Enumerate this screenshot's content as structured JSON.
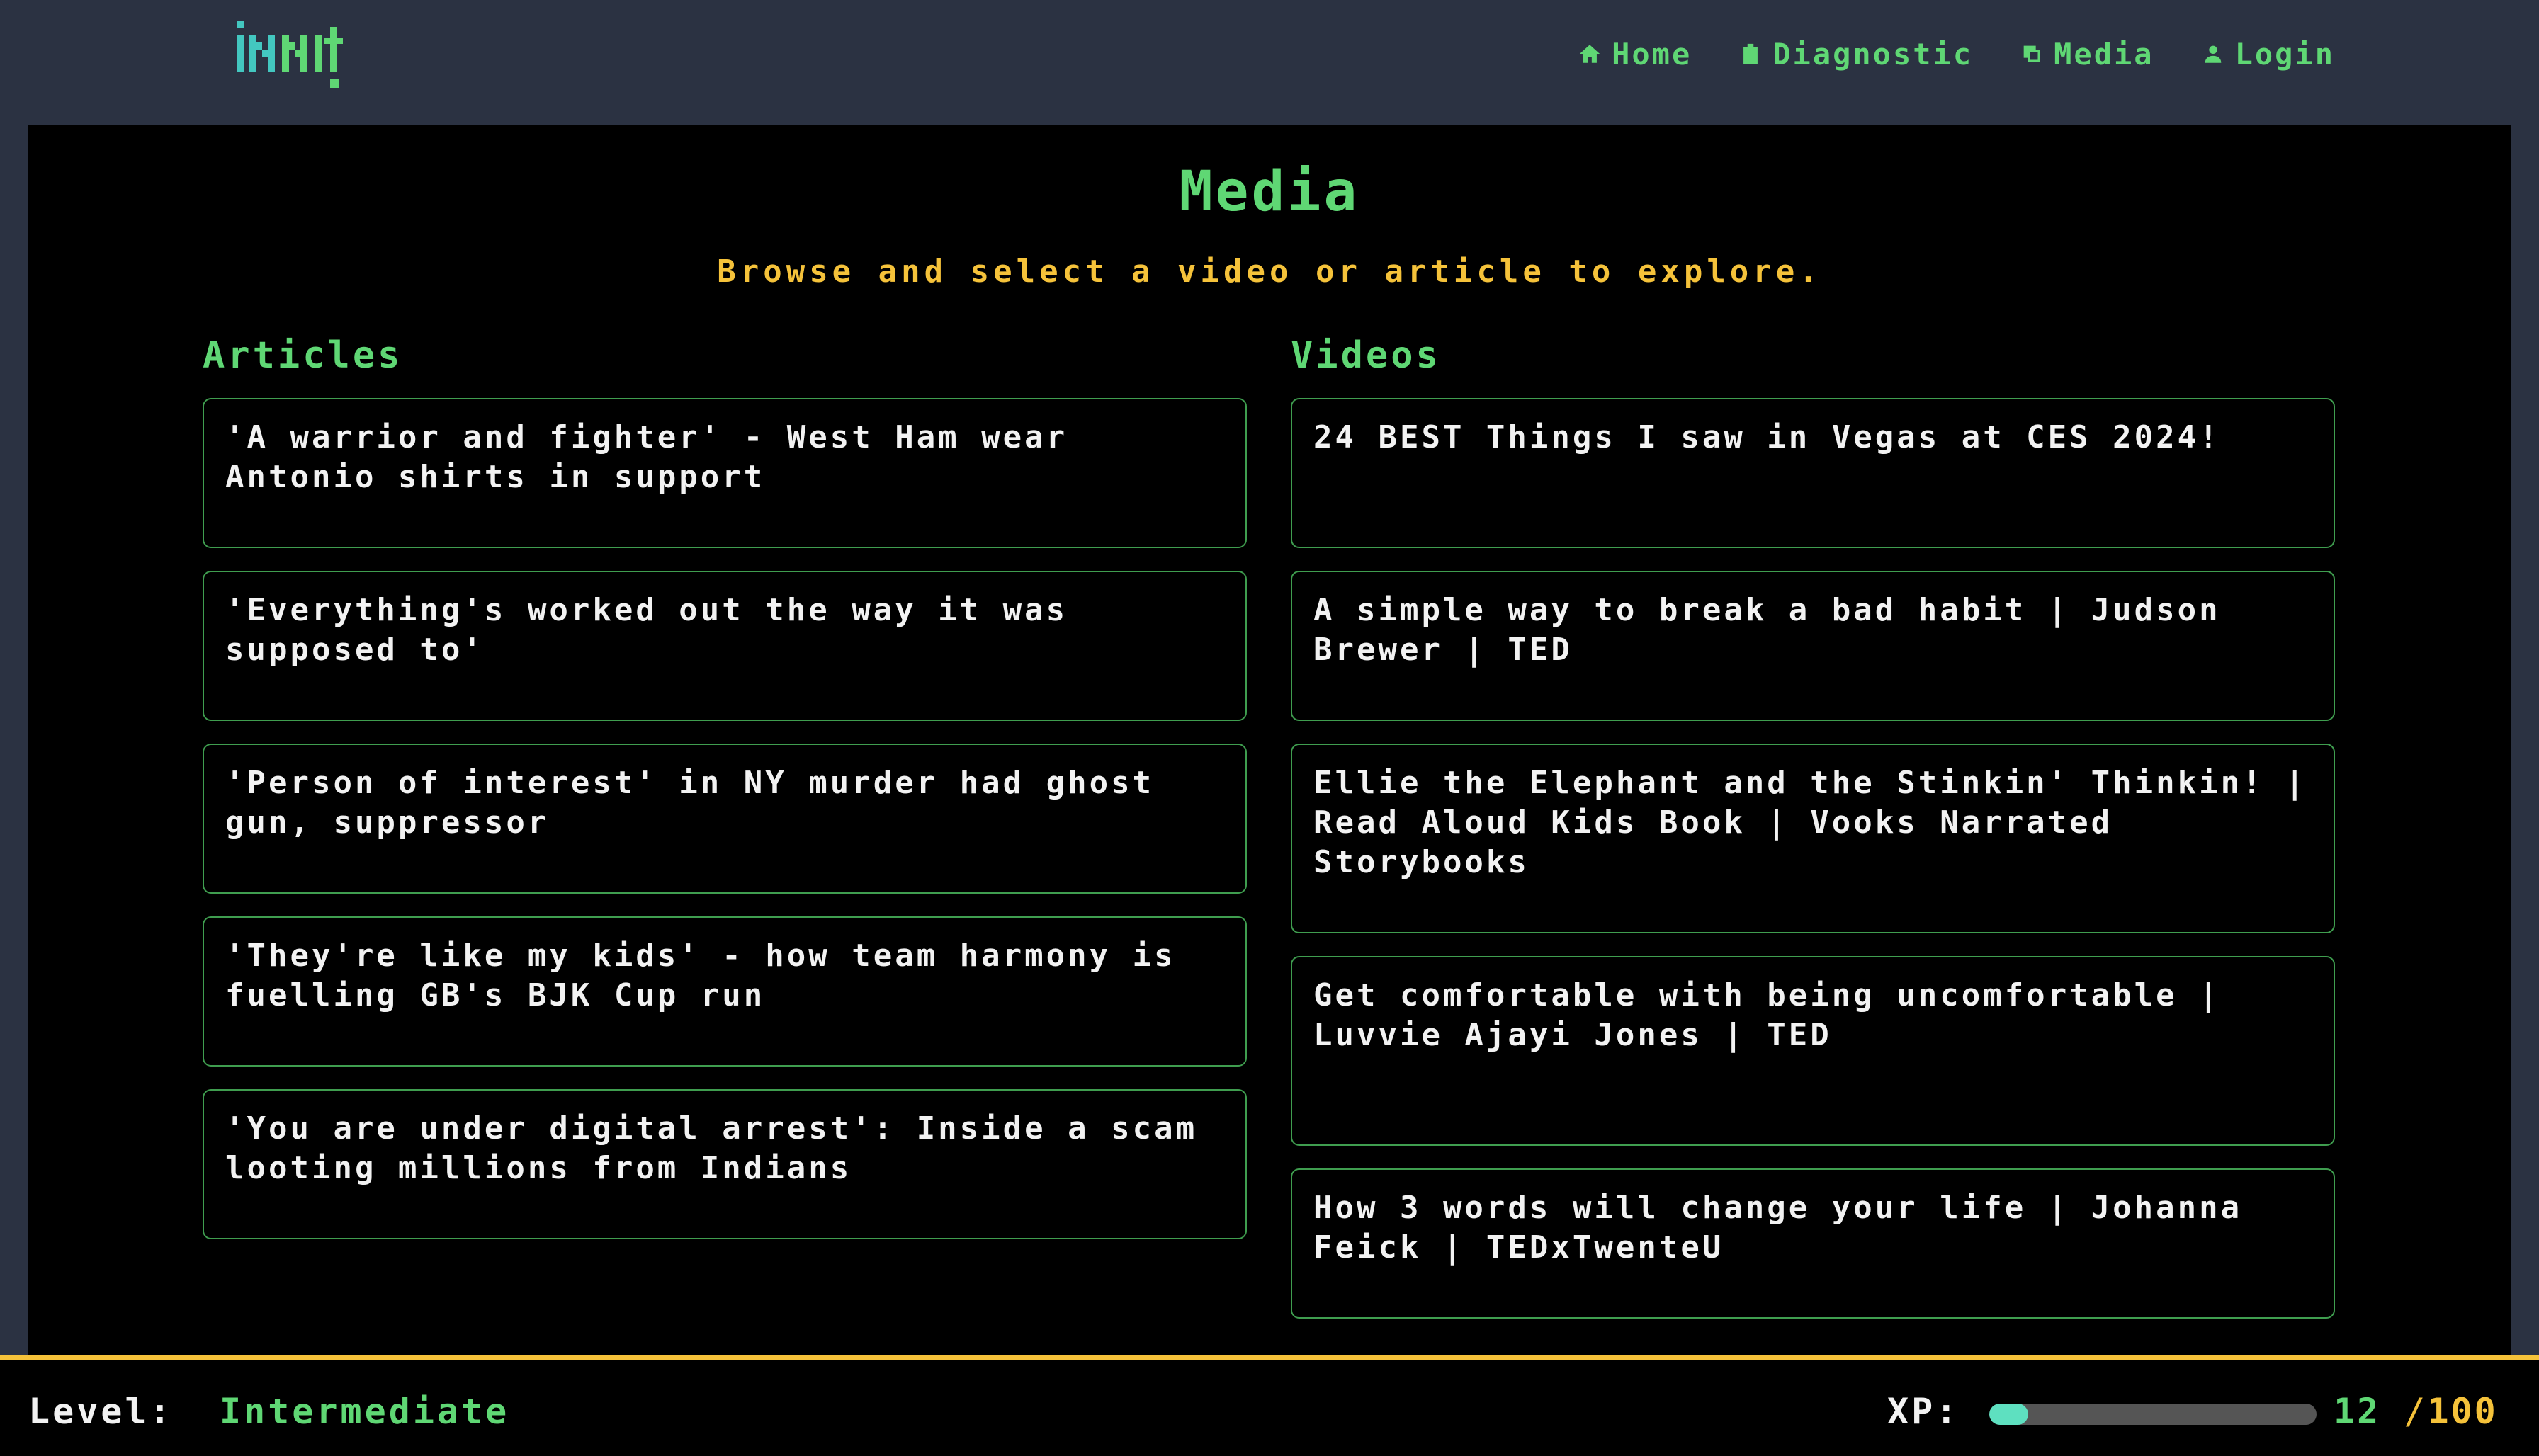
{
  "brand": {
    "logo_text": "INNIT"
  },
  "nav": [
    {
      "label": "Home",
      "icon": "home-icon"
    },
    {
      "label": "Diagnostic",
      "icon": "clipboard-icon"
    },
    {
      "label": "Media",
      "icon": "media-icon"
    },
    {
      "label": "Login",
      "icon": "user-icon"
    }
  ],
  "page": {
    "title": "Media",
    "subtitle": "Browse and select a video or article to explore."
  },
  "articles": {
    "heading": "Articles",
    "items": [
      "'A warrior and fighter' - West Ham wear Antonio shirts in support",
      "'Everything's worked out the way it was supposed to'",
      "'Person of interest' in NY murder had ghost gun, suppressor",
      "'They're like my kids' - how team harmony is fuelling GB's BJK Cup run",
      "'You are under digital arrest': Inside a scam looting millions from Indians"
    ]
  },
  "videos": {
    "heading": "Videos",
    "items": [
      "24 BEST Things I saw in Vegas at CES 2024!",
      "A simple way to break a bad habit | Judson Brewer | TED",
      "Ellie the Elephant and the Stinkin' Thinkin! | Read Aloud Kids Book | Vooks Narrated Storybooks",
      "Get comfortable with being uncomfortable | Luvvie Ajayi Jones | TED",
      "How 3 words will change your life | Johanna Feick | TEDxTwenteU"
    ]
  },
  "status": {
    "level_label": "Level:",
    "level_value": "Intermediate",
    "xp_label": "XP:",
    "xp_current": "12",
    "xp_separator": "/",
    "xp_max": "100",
    "xp_fraction": 0.12
  },
  "colors": {
    "accent_green": "#5fd774",
    "accent_yellow": "#f5c23a",
    "xp_fill": "#5ee0c0",
    "nav_bg": "#2b3242"
  }
}
